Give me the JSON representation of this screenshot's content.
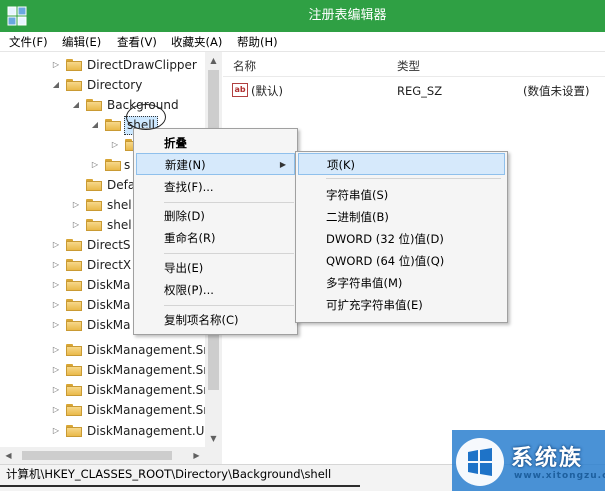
{
  "window": {
    "title": "注册表编辑器"
  },
  "menu": [
    "文件(F)",
    "编辑(E)",
    "查看(V)",
    "收藏夹(A)",
    "帮助(H)"
  ],
  "tree": {
    "nodes": [
      {
        "label": "DirectDrawClipper",
        "arrow": "▷"
      },
      {
        "label": "Directory",
        "arrow": "◢"
      },
      {
        "label": "Background",
        "arrow": "◢"
      },
      {
        "label": "shell",
        "arrow": "◢",
        "selected": true
      },
      {
        "label": "",
        "arrow": "▷"
      },
      {
        "label": "s",
        "arrow": "▷"
      },
      {
        "label": "Defa",
        "arrow": ""
      },
      {
        "label": "shel",
        "arrow": "▷"
      },
      {
        "label": "shel",
        "arrow": "▷"
      },
      {
        "label": "DirectS",
        "arrow": "▷"
      },
      {
        "label": "DirectX",
        "arrow": "▷"
      },
      {
        "label": "DiskMa",
        "arrow": "▷"
      },
      {
        "label": "DiskMa",
        "arrow": "▷"
      },
      {
        "label": "DiskMa",
        "arrow": "▷"
      },
      {
        "label": "DiskManagement.Sı",
        "arrow": "▷"
      },
      {
        "label": "DiskManagement.Sı",
        "arrow": "▷"
      },
      {
        "label": "DiskManagement.Sı",
        "arrow": "▷"
      },
      {
        "label": "DiskManagement.Sı",
        "arrow": "▷"
      },
      {
        "label": "DiskManagement.U",
        "arrow": "▷"
      }
    ]
  },
  "values": {
    "headers": {
      "name": "名称",
      "type": "类型",
      "data": ""
    },
    "rows": [
      {
        "icon": "ab",
        "name": "(默认)",
        "type": "REG_SZ",
        "data": "(数值未设置)"
      }
    ]
  },
  "context_menu": {
    "items": [
      "折叠",
      "新建(N)",
      "查找(F)...",
      "删除(D)",
      "重命名(R)",
      "导出(E)",
      "权限(P)...",
      "复制项名称(C)"
    ]
  },
  "submenu": {
    "items": [
      "项(K)",
      "字符串值(S)",
      "二进制值(B)",
      "DWORD (32 位)值(D)",
      "QWORD (64 位)值(Q)",
      "多字符串值(M)",
      "可扩充字符串值(E)"
    ]
  },
  "status": {
    "path": "计算机\\HKEY_CLASSES_ROOT\\Directory\\Background\\shell"
  },
  "watermark": {
    "brand": "系统族",
    "url": "www.xitongzu.com"
  },
  "colors": {
    "titlebar": "#2fa044",
    "highlight": "#d6e9fb",
    "selection": "#cde8ff"
  }
}
